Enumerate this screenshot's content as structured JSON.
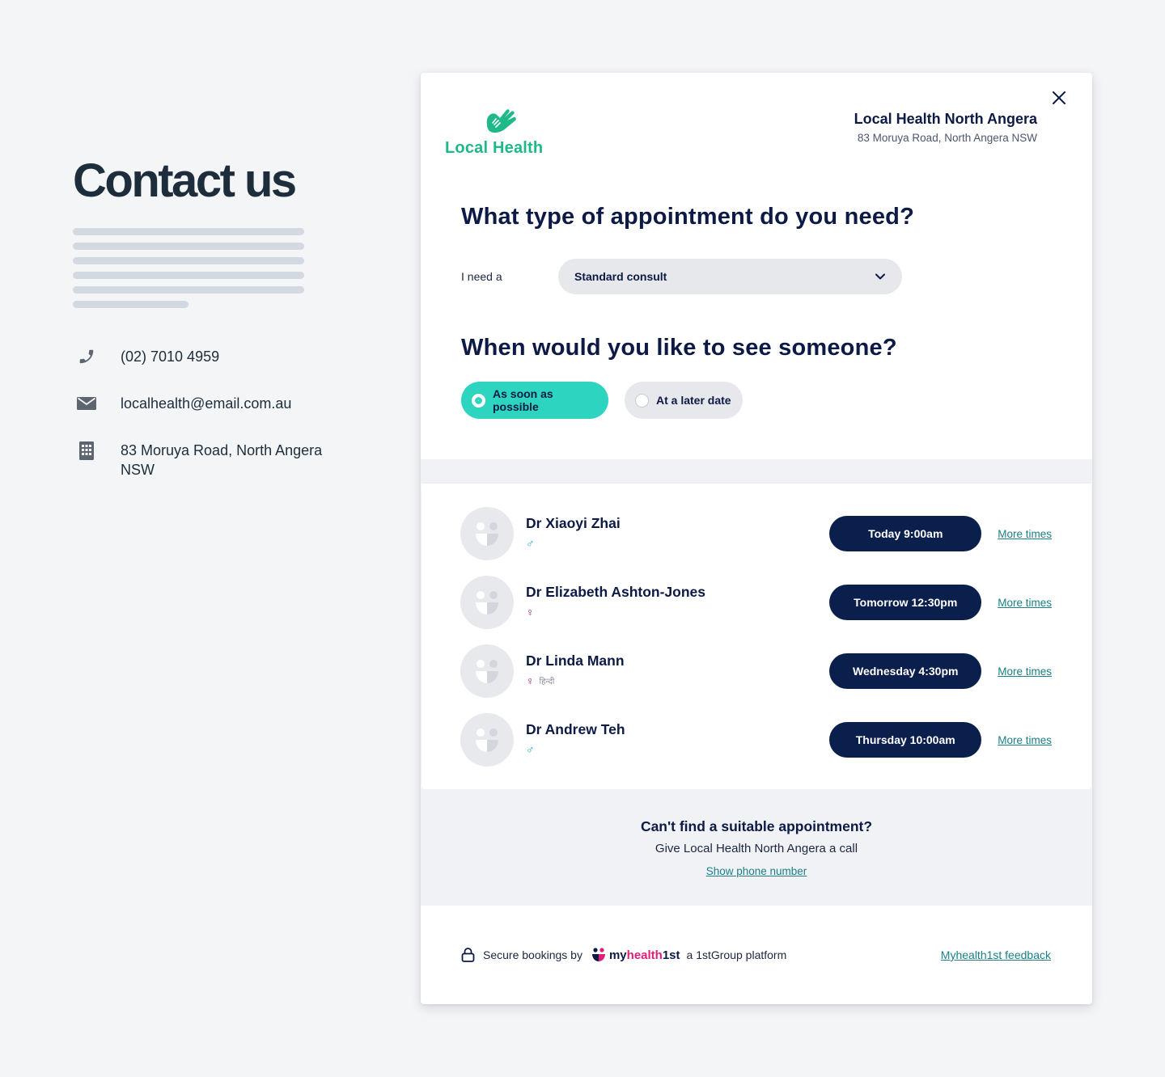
{
  "contact": {
    "title": "Contact us",
    "phone": "(02) 7010 4959",
    "email": "localhealth@email.com.au",
    "address": "83 Moruya Road, North Angera NSW",
    "icons": {
      "phone": "phone-icon",
      "email": "envelope-icon",
      "address": "building-icon"
    }
  },
  "modal": {
    "logo_text": "Local Health",
    "practice_name": "Local Health North Angera",
    "practice_address": "83 Moruya Road, North Angera NSW",
    "close_icon": "close-icon",
    "appointment_question": "What type of appointment do you need?",
    "need_label": "I need a",
    "appointment_type": "Standard consult",
    "when_question": "When would you like to see someone?",
    "when_options": [
      {
        "label": "As soon as possible",
        "selected": true
      },
      {
        "label": "At a later date",
        "selected": false
      }
    ],
    "doctors": [
      {
        "name": "Dr Xiaoyi Zhai",
        "gender": "♂",
        "gender_type": "male",
        "language": "",
        "next_time": "Today 9:00am",
        "more_label": "More times"
      },
      {
        "name": "Dr Elizabeth Ashton-Jones",
        "gender": "♀",
        "gender_type": "female",
        "language": "",
        "next_time": "Tomorrow 12:30pm",
        "more_label": "More times"
      },
      {
        "name": "Dr Linda Mann",
        "gender": "♀",
        "gender_type": "female",
        "language": "हिन्दी",
        "next_time": "Wednesday 4:30pm",
        "more_label": "More times"
      },
      {
        "name": "Dr Andrew Teh",
        "gender": "♂",
        "gender_type": "male",
        "language": "",
        "next_time": "Thursday 10:00am",
        "more_label": "More times"
      }
    ],
    "cant_find": {
      "title": "Can't find a suitable appointment?",
      "subtitle": "Give Local Health North Angera a call",
      "link": "Show phone number"
    },
    "footer": {
      "secure_text": "Secure bookings by",
      "brand_my": "my",
      "brand_health": "health",
      "brand_1st": "1st",
      "platform_text": "a 1stGroup platform",
      "feedback_link": "Myhealth1st feedback"
    }
  },
  "colors": {
    "navy": "#0b1f4d",
    "teal_selected": "#2dd4bf",
    "link_teal": "#1a7f86",
    "logo_green": "#1fb889",
    "brand_pink": "#e01e7a"
  }
}
